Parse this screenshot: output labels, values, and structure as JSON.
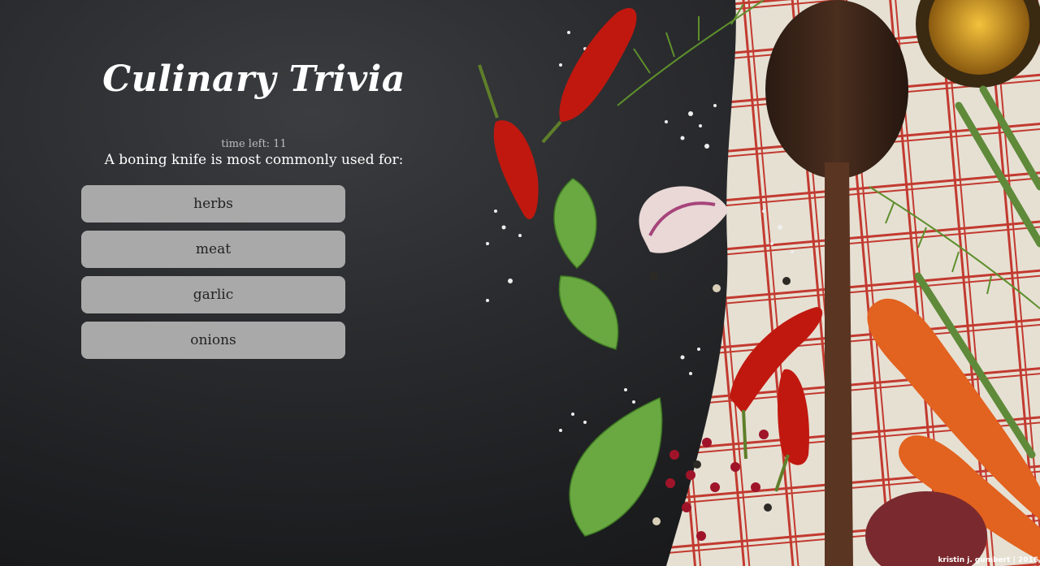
{
  "header": {
    "title": "Culinary Trivia"
  },
  "quiz": {
    "timer_text": "time left: 11",
    "question": "A boning knife is most commonly used for:",
    "answers": [
      {
        "label": "herbs"
      },
      {
        "label": "meat"
      },
      {
        "label": "garlic"
      },
      {
        "label": "onions"
      }
    ]
  },
  "footer": {
    "credit": "kristin j. gumbert | 2016"
  },
  "background": {
    "description_icons": [
      "chili-pepper-icon",
      "basil-leaf-icon",
      "garlic-icon",
      "wooden-spoon-icon",
      "carrot-icon",
      "asparagus-icon",
      "salt-icon",
      "peppercorn-icon",
      "olive-oil-bowl-icon",
      "red-potato-icon",
      "herb-sprig-icon"
    ],
    "colors": {
      "slate": "#2a2b2e",
      "button": "#a9a9a9",
      "chili": "#b3140d",
      "basil": "#5f9e3a",
      "carrot": "#e8611f",
      "spoon": "#3a2418",
      "cloth": "#e8e2d6",
      "cloth_stripe": "#c0352e"
    }
  }
}
